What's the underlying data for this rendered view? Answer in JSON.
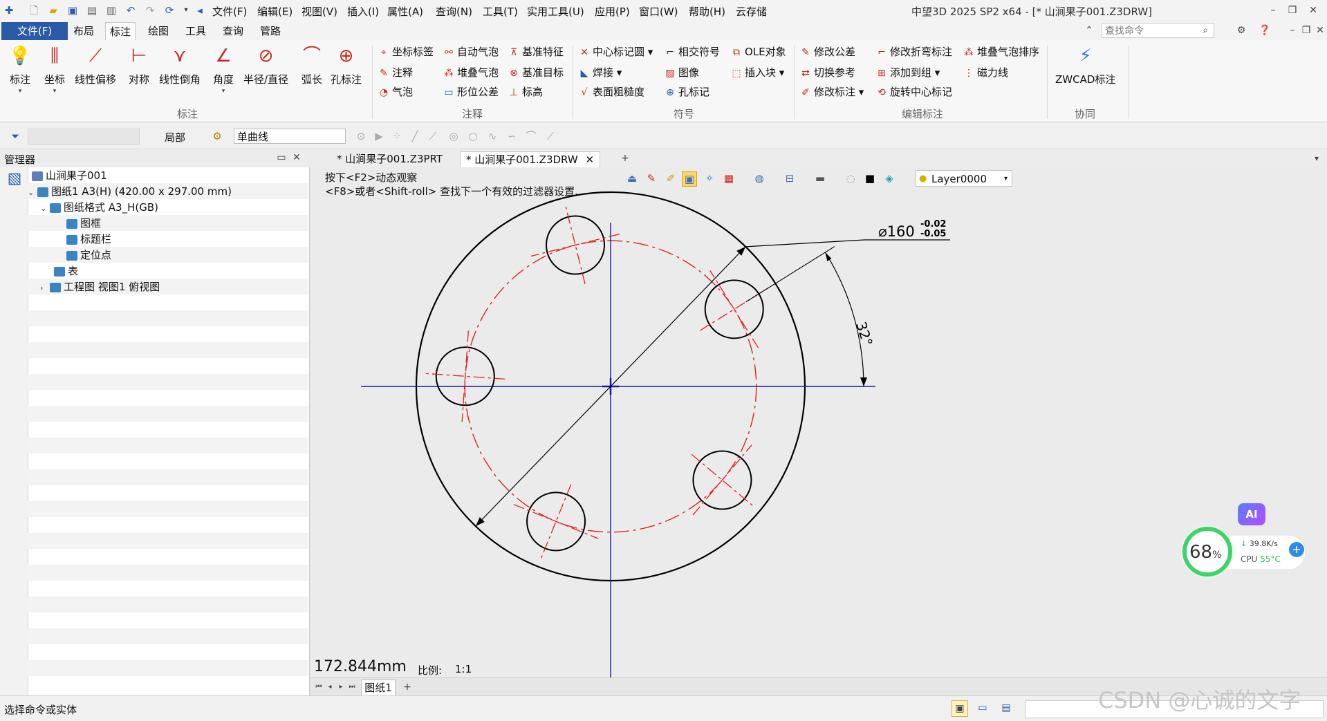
{
  "app_title": "中望3D 2025 SP2 x64 - [* 山涧果子001.Z3DRW]",
  "menu": [
    "文件(F)",
    "编辑(E)",
    "视图(V)",
    "插入(I)",
    "属性(A)",
    "查询(N)",
    "工具(T)",
    "实用工具(U)",
    "应用(P)",
    "窗口(W)",
    "帮助(H)",
    "云存储"
  ],
  "ribbon_tabs": {
    "file": "文件(F)",
    "layout": "布局",
    "mark": "标注",
    "draw": "绘图",
    "tools": "工具",
    "query": "查询",
    "pipe": "管路"
  },
  "search_placeholder": "查找命令",
  "ribbon": {
    "big": [
      "标注",
      "坐标",
      "线性偏移",
      "对称",
      "线性倒角",
      "角度",
      "半径/直径",
      "弧长",
      "孔标注"
    ],
    "g1": "标注",
    "annot": [
      "坐标标签",
      "注释",
      "气泡",
      "自动气泡",
      "堆叠气泡",
      "形位公差",
      "基准特征",
      "基准目标",
      "标高"
    ],
    "g2": "注释",
    "symbols": [
      "中心标记圆",
      "焊接",
      "表面粗糙度",
      "相交符号",
      "图像",
      "孔标记",
      "OLE对象",
      "插入块"
    ],
    "g3": "符号",
    "edit": [
      "修改公差",
      "切换参考",
      "修改标注",
      "修改折弯标注",
      "添加到组",
      "旋转中心标记",
      "堆叠气泡排序",
      "磁力线"
    ],
    "g4": "编辑标注",
    "collab": "ZWCAD标注",
    "g5": "协同"
  },
  "toolrow": {
    "local": "局部",
    "curve": "单曲线"
  },
  "manager": {
    "title": "管理器",
    "tree": [
      "山涧果子001",
      "图纸1 A3(H) (420.00 x 297.00 mm)",
      "图纸格式 A3_H(GB)",
      "图框",
      "标题栏",
      "定位点",
      "表",
      "工程图 视图1 俯视图"
    ]
  },
  "doc_tabs": [
    "* 山涧果子001.Z3PRT",
    "* 山涧果子001.Z3DRW"
  ],
  "canvas": {
    "hint1": "按下<F2>动态观察",
    "hint2": "<F8>或者<Shift-roll> 查找下一个有效的过滤器设置.",
    "layer": "Layer0000",
    "dim_diameter": "⌀160",
    "tol_upper": "-0.02",
    "tol_lower": "-0.05",
    "angle": "32°",
    "readout": "172.844mm",
    "scale_label": "比例:",
    "scale_value": "1:1"
  },
  "sheet_tab": "图纸1",
  "status_text": "选择命令或实体",
  "watermark": "CSDN @心诚的文字",
  "perf": {
    "percent": "68",
    "unit": "%",
    "net": "39.8K/s",
    "cpu_label": "CPU",
    "cpu_temp": "55°C",
    "ai": "AI"
  },
  "drawing": {
    "outer_diameter": 160,
    "hole_circle_diameter": 120,
    "hole_count": 5,
    "hole_angle_offset_deg": 32
  },
  "colors": {
    "accent": "#2b5aa8",
    "centerline": "#e02020",
    "axis": "#1a1aa8",
    "outline": "#000000"
  }
}
